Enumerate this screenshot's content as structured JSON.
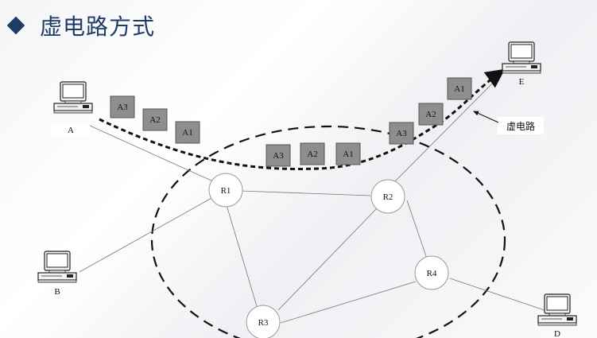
{
  "title": "虚电路方式",
  "colors": {
    "title": "#1f3b66",
    "packet_fill": "#8e8e8e",
    "packet_stroke": "#555555"
  },
  "hosts": {
    "A": "A",
    "B": "B",
    "D": "D",
    "E": "E"
  },
  "routers": {
    "R1": "R1",
    "R2": "R2",
    "R3": "R3",
    "R4": "R4"
  },
  "packets": {
    "source_group": [
      "A3",
      "A2",
      "A1"
    ],
    "middle_group": [
      "A3",
      "A2",
      "A1"
    ],
    "dest_group": [
      "A3",
      "A2",
      "A1"
    ]
  },
  "virtual_circuit_label": "虚电路"
}
